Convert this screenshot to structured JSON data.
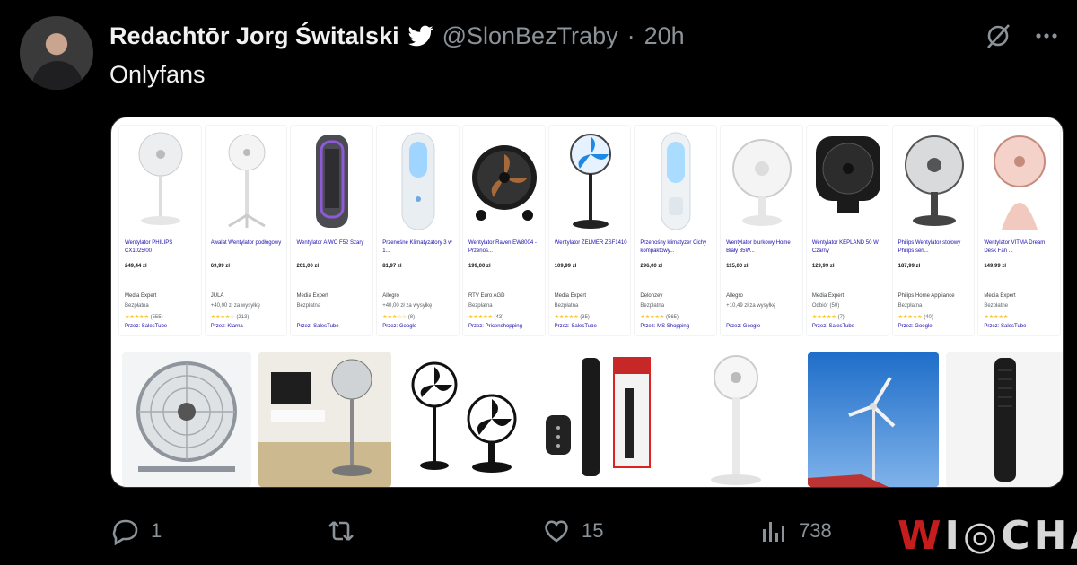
{
  "tweet": {
    "author_name": "Redachtōr Jorg Świtalski",
    "handle": "@SlonBezTraby",
    "separator": "·",
    "time": "20h",
    "text": "Onlyfans",
    "verified_color": "#1d9bf0"
  },
  "products": [
    {
      "title": "Wentylator PHILIPS CX1025/00",
      "price": "249,44 zł",
      "store": "Media Expert",
      "ship": "Bezpłatna",
      "stars": "★★★★★",
      "reviews": "(555)",
      "via": "Przez: SalesTube"
    },
    {
      "title": "Awalat Wentylator podłogowy",
      "price": "69,99 zł",
      "store": "JULA",
      "ship": "+40,00 zł za wysyłkę",
      "stars": "★★★★☆",
      "reviews": "(213)",
      "via": "Przez: Klarna"
    },
    {
      "title": "Wentylator AIWO F52 Szary",
      "price": "201,00 zł",
      "store": "Media Expert",
      "ship": "Bezpłatna",
      "stars": "",
      "reviews": "",
      "via": "Przez: SalesTube"
    },
    {
      "title": "Przenośne Klimatyzatory 3 w 1...",
      "price": "81,97 zł",
      "store": "Allegro",
      "ship": "+40,00 zł za wysyłkę",
      "stars": "★★★☆☆",
      "reviews": "(8)",
      "via": "Przez: Google"
    },
    {
      "title": "Wentylator Raven EW8004 - Przenoś...",
      "price": "199,00 zł",
      "store": "RTV Euro AGD",
      "ship": "Bezpłatna",
      "stars": "★★★★★",
      "reviews": "(43)",
      "via": "Przez: Pricenshopping"
    },
    {
      "title": "Wentylator ZELMER ZSF1410",
      "price": "109,99 zł",
      "store": "Media Expert",
      "ship": "Bezpłatna",
      "stars": "★★★★★",
      "reviews": "(35)",
      "via": "Przez: SalesTube"
    },
    {
      "title": "Przenośny klimatyzer Cichy kompaktowy...",
      "price": "296,00 zł",
      "store": "Delonzey",
      "ship": "Bezpłatna",
      "stars": "★★★★★",
      "reviews": "(565)",
      "via": "Przez: MS Shopping"
    },
    {
      "title": "Wentylator biurkowy Home Biały 35W...",
      "price": "115,00 zł",
      "store": "Allegro",
      "ship": "+10,49 zł za wysyłkę",
      "stars": "",
      "reviews": "",
      "via": "Przez: Google"
    },
    {
      "title": "Wentylator KEPLAND 50 W Czarny",
      "price": "129,99 zł",
      "store": "Media Expert",
      "ship": "Odbiór (50)",
      "stars": "★★★★★",
      "reviews": "(7)",
      "via": "Przez: SalesTube"
    },
    {
      "title": "Philips Wentylator stołowy Philips seri...",
      "price": "187,99 zł",
      "store": "Philips Home Appliance",
      "ship": "Bezpłatna",
      "stars": "★★★★★",
      "reviews": "(40)",
      "via": "Przez: Google"
    },
    {
      "title": "Wentylator VITMA Dream Desk Fan ...",
      "price": "149,99 zł",
      "store": "Media Expert",
      "ship": "Bezpłatne",
      "stars": "★★★★★",
      "reviews": "",
      "via": "Przez: SalesTube"
    }
  ],
  "actions": {
    "replies": "1",
    "retweets": "",
    "likes": "15",
    "views": "738"
  },
  "watermark": {
    "first": "W",
    "rest": "I◎CHA"
  },
  "icon_color": "#8b9298"
}
